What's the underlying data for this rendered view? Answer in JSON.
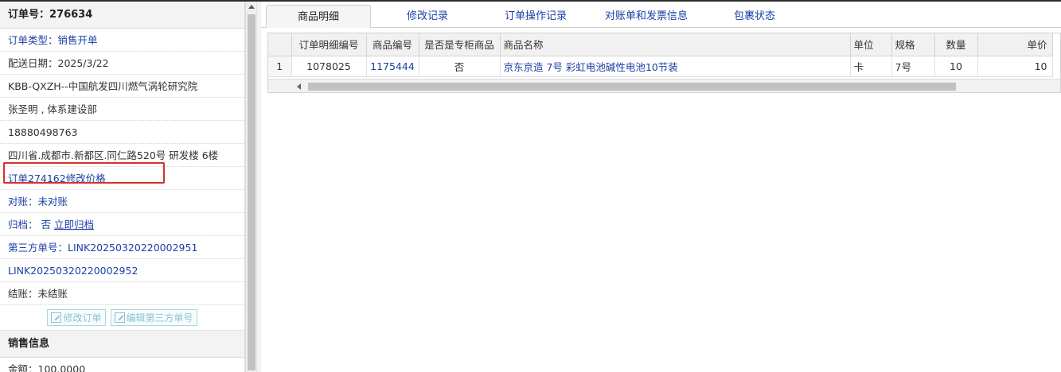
{
  "order": {
    "header": "订单号：276634",
    "rows": [
      {
        "text": "订单类型：销售开单"
      },
      {
        "text": "配送日期：2025/3/22"
      },
      {
        "text": "KBB-QXZH--中国航发四川燃气涡轮研究院"
      },
      {
        "text": "张圣明 , 体系建设部"
      },
      {
        "text": "18880498763"
      },
      {
        "text": "四川省.成都市.新都区.同仁路520号 研发楼 6楼"
      },
      {
        "text": "订单274162修改价格"
      },
      {
        "text": "对账：未对账"
      },
      {
        "label": "归档：",
        "value": "否",
        "link": "立即归档"
      },
      {
        "text": "第三方单号：LINK20250320220002951"
      },
      {
        "text": "LINK20250320220002952"
      },
      {
        "text": "结账：未结账"
      }
    ],
    "buttons": {
      "edit_order": "修改订单",
      "edit_third_party": "编辑第三方单号"
    }
  },
  "sales": {
    "header": "销售信息",
    "amount": "金额：100.0000"
  },
  "tabs": [
    "商品明细",
    "修改记录",
    "订单操作记录",
    "对账单和发票信息",
    "包裹状态"
  ],
  "active_tab": "商品明细",
  "table": {
    "columns": [
      "订单明细编号",
      "商品编号",
      "是否是专柜商品",
      "商品名称",
      "单位",
      "规格",
      "数量",
      "单价"
    ],
    "rows": [
      {
        "index": "1",
        "detail_id": "1078025",
        "product_id": "1175444",
        "is_counter": "否",
        "name": "京东京造 7号 彩虹电池碱性电池10节装",
        "unit": "卡",
        "spec": "7号",
        "qty": "10",
        "price": "10"
      }
    ]
  },
  "colors": {
    "link_blue": "#1a3fa6",
    "highlight_red": "#d9302c"
  }
}
